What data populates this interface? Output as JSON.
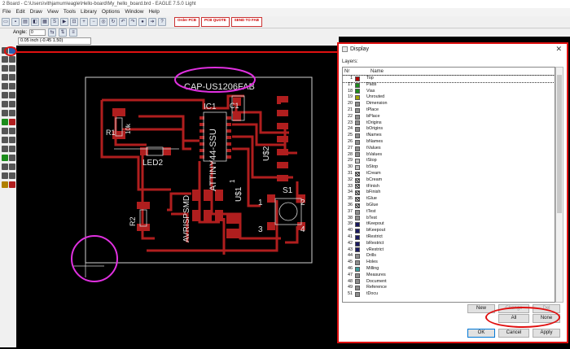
{
  "window": {
    "title": "2 Board - C:\\Users\\vithjamum\\eagle\\Hello-board\\My_hello_board.brd - EAGLE 7.5.0 Light"
  },
  "menu": [
    "File",
    "Edit",
    "Draw",
    "View",
    "Tools",
    "Library",
    "Options",
    "Window",
    "Help"
  ],
  "toolbar": {
    "logos": [
      "Order PCB",
      "PCB QUOTE",
      "SEND TO FAB"
    ],
    "angle_label": "Angle:",
    "angle_value": "0"
  },
  "coord_readout": "0.05 inch (-0.45 1.50)",
  "board_labels": {
    "cap": "CAP-US1206FAB",
    "c1": "C1",
    "ic1": "IC1",
    "attiny": "ATTINY44-SSU",
    "r1": "R1",
    "r1val": "10k",
    "led2": "LED2",
    "r2": "R2",
    "u2": "U$2",
    "u1": "U$1",
    "avr": "AVRISPSMD",
    "s1": "S1",
    "p1": "1",
    "p2": "2",
    "p3": "3",
    "p4": "4",
    "one": "1"
  },
  "dialog": {
    "title": "Display",
    "close": "✕",
    "layers_label": "Layers:",
    "col_nr": "Nr",
    "col_name": "Name",
    "layers": [
      {
        "nr": "1",
        "name": "Top",
        "color": "#b00000",
        "style": "solid"
      },
      {
        "nr": "17",
        "name": "Pads",
        "color": "#1c8c1c",
        "style": "solid"
      },
      {
        "nr": "18",
        "name": "Vias",
        "color": "#1c8c1c",
        "style": "solid"
      },
      {
        "nr": "19",
        "name": "Unrouted",
        "color": "#a0a000",
        "style": "solid"
      },
      {
        "nr": "20",
        "name": "Dimension",
        "color": "#8c8c8c",
        "style": "solid"
      },
      {
        "nr": "21",
        "name": "tPlace",
        "color": "#8c8c8c",
        "style": "solid"
      },
      {
        "nr": "22",
        "name": "bPlace",
        "color": "#8c8c8c",
        "style": "solid"
      },
      {
        "nr": "23",
        "name": "tOrigins",
        "color": "#8c8c8c",
        "style": "solid"
      },
      {
        "nr": "24",
        "name": "bOrigins",
        "color": "#8c8c8c",
        "style": "solid"
      },
      {
        "nr": "25",
        "name": "tNames",
        "color": "#8c8c8c",
        "style": "solid"
      },
      {
        "nr": "26",
        "name": "bNames",
        "color": "#8c8c8c",
        "style": "solid"
      },
      {
        "nr": "27",
        "name": "tValues",
        "color": "#8c8c8c",
        "style": "solid"
      },
      {
        "nr": "28",
        "name": "bValues",
        "color": "#8c8c8c",
        "style": "solid"
      },
      {
        "nr": "29",
        "name": "tStop",
        "color": "#222222",
        "style": "dots"
      },
      {
        "nr": "30",
        "name": "bStop",
        "color": "#222222",
        "style": "dots"
      },
      {
        "nr": "31",
        "name": "tCream",
        "color": "#444444",
        "style": "hatch"
      },
      {
        "nr": "32",
        "name": "bCream",
        "color": "#444444",
        "style": "hatch"
      },
      {
        "nr": "33",
        "name": "tFinish",
        "color": "#444444",
        "style": "hatch"
      },
      {
        "nr": "34",
        "name": "bFinish",
        "color": "#444444",
        "style": "hatch"
      },
      {
        "nr": "35",
        "name": "tGlue",
        "color": "#444444",
        "style": "hatch"
      },
      {
        "nr": "36",
        "name": "bGlue",
        "color": "#444444",
        "style": "hatch"
      },
      {
        "nr": "37",
        "name": "tTest",
        "color": "#8c8c8c",
        "style": "solid"
      },
      {
        "nr": "38",
        "name": "bTest",
        "color": "#8c8c8c",
        "style": "solid"
      },
      {
        "nr": "39",
        "name": "tKeepout",
        "color": "#1a1a60",
        "style": "solid"
      },
      {
        "nr": "40",
        "name": "bKeepout",
        "color": "#1a1a60",
        "style": "solid"
      },
      {
        "nr": "41",
        "name": "tRestrict",
        "color": "#1a1a60",
        "style": "solid"
      },
      {
        "nr": "42",
        "name": "bRestrict",
        "color": "#1a1a60",
        "style": "solid"
      },
      {
        "nr": "43",
        "name": "vRestrict",
        "color": "#1a1a60",
        "style": "solid"
      },
      {
        "nr": "44",
        "name": "Drills",
        "color": "#8c8c8c",
        "style": "solid"
      },
      {
        "nr": "45",
        "name": "Holes",
        "color": "#8c8c8c",
        "style": "solid"
      },
      {
        "nr": "46",
        "name": "Milling",
        "color": "#3c9c9c",
        "style": "solid"
      },
      {
        "nr": "47",
        "name": "Measures",
        "color": "#8c8c8c",
        "style": "solid"
      },
      {
        "nr": "48",
        "name": "Document",
        "color": "#8c8c8c",
        "style": "solid"
      },
      {
        "nr": "49",
        "name": "Reference",
        "color": "#8c8c8c",
        "style": "solid"
      },
      {
        "nr": "51",
        "name": "tDocu",
        "color": "#8c8c8c",
        "style": "solid"
      }
    ],
    "buttons": {
      "new": "New",
      "change": "Change",
      "del": "Del",
      "all": "All",
      "none": "None",
      "ok": "OK",
      "cancel": "Cancel",
      "apply": "Apply"
    }
  },
  "colors": {
    "copper": "#b01e1e",
    "annotation_red": "#e01010",
    "annotation_magenta": "#e030e0"
  }
}
